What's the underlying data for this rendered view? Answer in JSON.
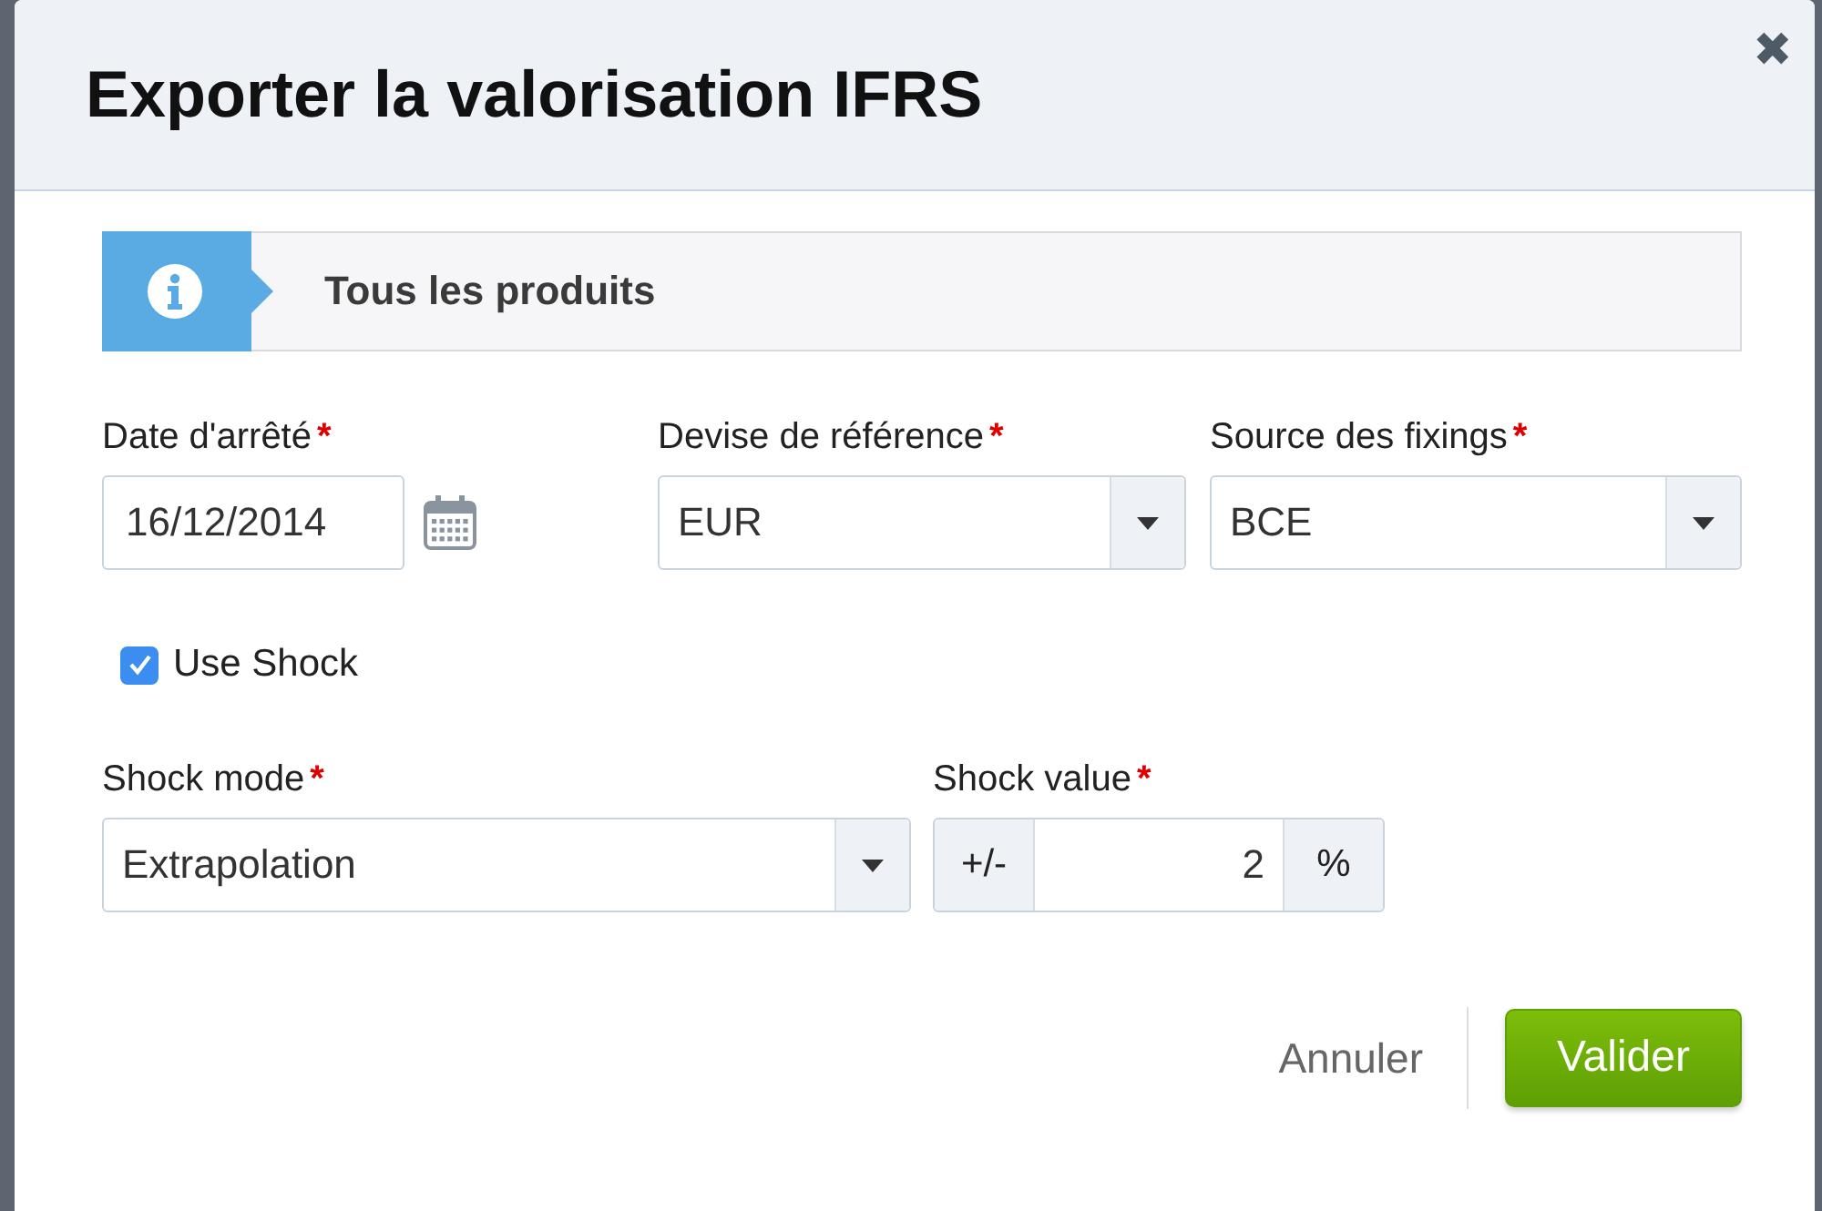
{
  "dialog": {
    "title": "Exporter la valorisation IFRS",
    "close": "✖"
  },
  "banner": {
    "text": "Tous les produits"
  },
  "row_1": [
    {
      "kind": "date",
      "label": "Date d'arrêté",
      "required_mark": "*",
      "value": "16/12/2014"
    },
    {
      "kind": "select",
      "label": "Devise de référence",
      "required_mark": "*",
      "value": "EUR"
    },
    {
      "kind": "select",
      "label": "Source des fixings",
      "required_mark": "*",
      "value": "BCE"
    }
  ],
  "use_shock": {
    "label": "Use Shock",
    "checked": true
  },
  "row_2": [
    {
      "kind": "select",
      "label": "Shock mode",
      "required_mark": "*",
      "value": "Extrapolation"
    },
    {
      "kind": "number",
      "label": "Shock value",
      "required_mark": "*",
      "prefix": "+/-",
      "value": "2",
      "suffix": "%"
    }
  ],
  "buttons": {
    "cancel": "Annuler",
    "confirm": "Valider"
  }
}
